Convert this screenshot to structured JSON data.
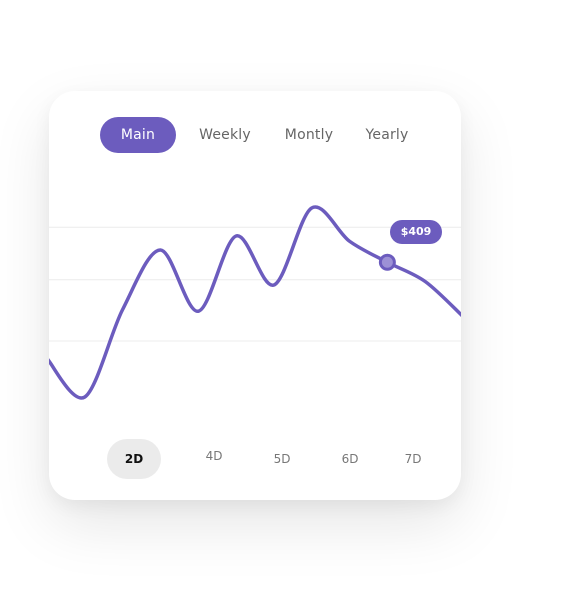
{
  "tabs": [
    {
      "label": "Main",
      "active": true
    },
    {
      "label": "Weekly",
      "active": false
    },
    {
      "label": "Montly",
      "active": false
    },
    {
      "label": "Yearly",
      "active": false
    }
  ],
  "tooltip": "$409",
  "periods": [
    {
      "label": "2D",
      "active": true
    },
    {
      "label": "4D",
      "active": false
    },
    {
      "label": "5D",
      "active": false
    },
    {
      "label": "6D",
      "active": false
    },
    {
      "label": "7D",
      "active": false
    }
  ],
  "colors": {
    "accent": "#6c5cbe",
    "marker_fill": "#9d91d6",
    "gridline": "#ececec",
    "active_period_bg": "#ebebeb"
  },
  "chart_data": {
    "type": "line",
    "series": [
      {
        "values": [
          0.3,
          0.08,
          0.58,
          0.92,
          0.57,
          1.0,
          0.72,
          1.16,
          0.97,
          0.85,
          0.74,
          0.54
        ]
      }
    ],
    "highlight": {
      "index": 9,
      "label": "$409"
    },
    "grid": true,
    "gridline_values": [
      0.4,
      0.75,
      1.05
    ]
  }
}
